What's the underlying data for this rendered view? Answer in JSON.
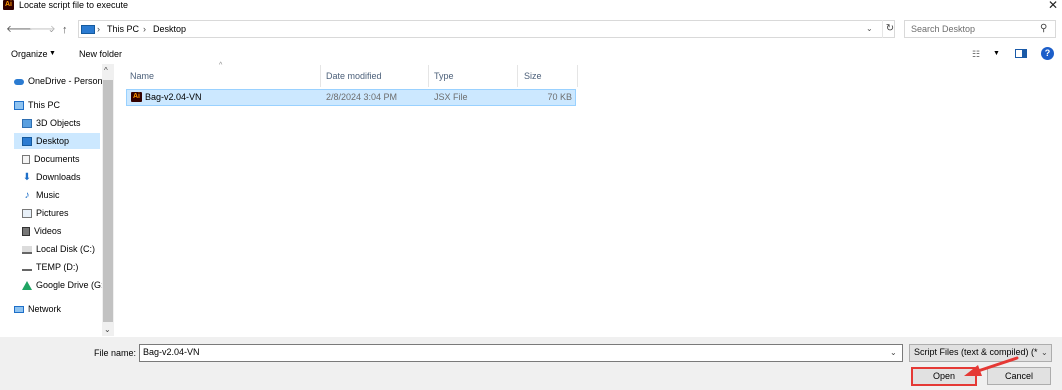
{
  "window": {
    "title": "Locate script file to execute",
    "app_icon_text": "Ai",
    "close_glyph": "✕"
  },
  "address": {
    "breadcrumbs": [
      "This PC",
      "Desktop"
    ],
    "separator": "›",
    "search_placeholder": "Search Desktop"
  },
  "toolbar": {
    "organize_label": "Organize",
    "new_folder_label": "New folder"
  },
  "sidebar": {
    "items": [
      {
        "label": "OneDrive - Person",
        "icon": "cloud-icon"
      },
      {
        "label": "This PC",
        "icon": "computer-icon"
      },
      {
        "label": "3D Objects",
        "icon": "cube-icon"
      },
      {
        "label": "Desktop",
        "icon": "desktop-icon",
        "selected": true
      },
      {
        "label": "Documents",
        "icon": "document-icon"
      },
      {
        "label": "Downloads",
        "icon": "download-icon"
      },
      {
        "label": "Music",
        "icon": "music-icon"
      },
      {
        "label": "Pictures",
        "icon": "picture-icon"
      },
      {
        "label": "Videos",
        "icon": "video-icon"
      },
      {
        "label": "Local Disk (C:)",
        "icon": "disk-icon"
      },
      {
        "label": "TEMP (D:)",
        "icon": "drive-icon"
      },
      {
        "label": "Google Drive (G:",
        "icon": "google-drive-icon"
      },
      {
        "label": "Network",
        "icon": "network-icon"
      }
    ]
  },
  "file_list": {
    "columns": [
      "Name",
      "Date modified",
      "Type",
      "Size"
    ],
    "rows": [
      {
        "name": "Bag-v2.04-VN",
        "date": "2/8/2024 3:04 PM",
        "type": "JSX File",
        "size": "70 KB",
        "icon_text": "Ai"
      }
    ]
  },
  "footer": {
    "filename_label": "File name:",
    "filename_value": "Bag-v2.04-VN",
    "filetype_value": "Script Files (text & compiled) (*",
    "open_label": "Open",
    "cancel_label": "Cancel"
  },
  "colors": {
    "selection": "#cce8ff",
    "highlight_border": "#e53935",
    "ai_brand_bg": "#330000",
    "ai_brand_fg": "#ff9a00"
  }
}
